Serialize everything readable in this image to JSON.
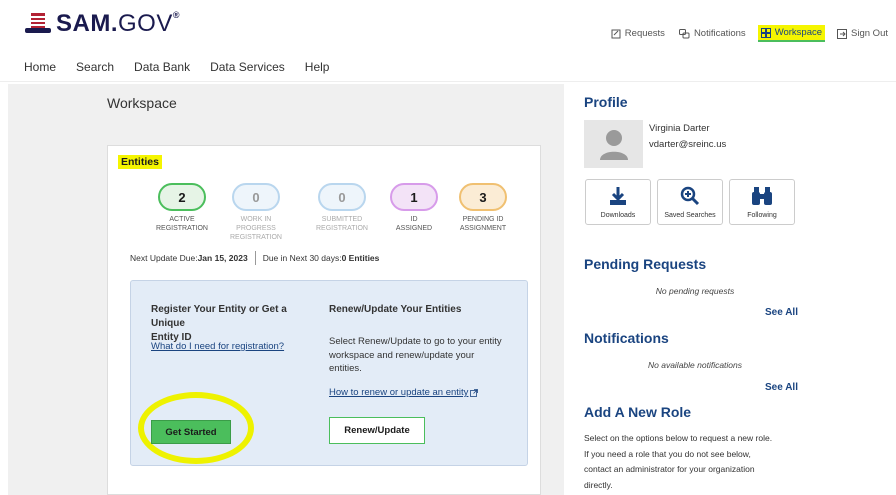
{
  "header": {
    "logo_main": "SAM.",
    "logo_gov": "GOV",
    "logo_reg": "®",
    "util_nav": [
      {
        "label": "Requests",
        "icon": "requests-icon"
      },
      {
        "label": "Notifications",
        "icon": "notifications-icon"
      },
      {
        "label": "Workspace",
        "icon": "workspace-icon"
      },
      {
        "label": "Sign Out",
        "icon": "signout-icon"
      }
    ]
  },
  "main_nav": [
    "Home",
    "Search",
    "Data Bank",
    "Data Services",
    "Help"
  ],
  "workspace": {
    "title": "Workspace",
    "entities_label": "Entities",
    "stats": [
      {
        "value": "2",
        "label1": "ACTIVE",
        "label2": "REGISTRATION"
      },
      {
        "value": "0",
        "label1": "WORK IN PROGRESS",
        "label2": "REGISTRATION"
      },
      {
        "value": "0",
        "label1": "SUBMITTED",
        "label2": "REGISTRATION"
      },
      {
        "value": "1",
        "label1": "ID",
        "label2": "ASSIGNED"
      },
      {
        "value": "3",
        "label1": "PENDING ID",
        "label2": "ASSIGNMENT"
      }
    ],
    "next_update_prefix": "Next Update Due: ",
    "next_update_date": "Jan 15, 2023",
    "due_prefix": "Due in Next 30 days: ",
    "due_value": "0 Entities",
    "register": {
      "heading_line1": "Register Your Entity or Get a Unique",
      "heading_line2": "Entity ID",
      "link": "What do I need for registration?",
      "button": "Get Started"
    },
    "renew": {
      "heading": "Renew/Update Your Entities",
      "text_line1": "Select Renew/Update to go to your entity",
      "text_line2": "workspace and renew/update your",
      "text_line3": "entities.",
      "link": "How to renew or update an entity",
      "button": "Renew/Update"
    }
  },
  "profile": {
    "title": "Profile",
    "name": "Virginia Darter",
    "email": "vdarter@sreinc.us",
    "tiles": [
      "Downloads",
      "Saved Searches",
      "Following"
    ]
  },
  "pending": {
    "title": "Pending Requests",
    "empty": "No pending requests",
    "see_all": "See All"
  },
  "notifications": {
    "title": "Notifications",
    "empty": "No available notifications",
    "see_all": "See All"
  },
  "add_role": {
    "title": "Add A New Role",
    "line1": "Select on the options below to request a new role.",
    "line2": "If you need a role that you do not see below,",
    "line3": "contact an administrator for your organization",
    "line4": "directly."
  },
  "colors": {
    "accent_blue": "#1a4480",
    "highlight_yellow": "#f5f500",
    "button_green": "#4bbe5c"
  }
}
